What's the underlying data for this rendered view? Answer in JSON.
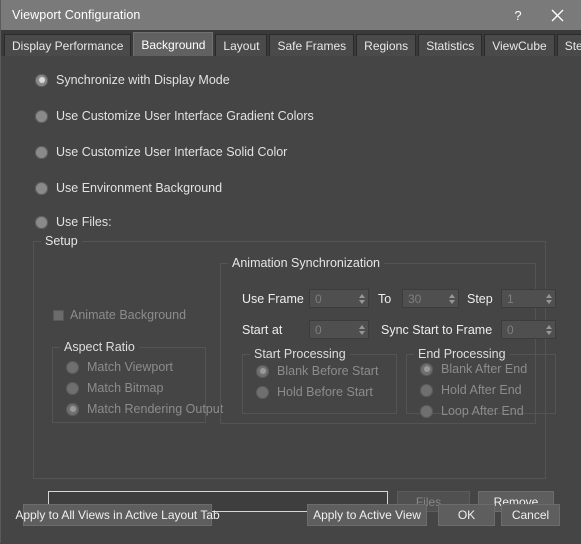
{
  "window": {
    "title": "Viewport Configuration",
    "help_label": "?",
    "close_label": "✕"
  },
  "tabs": [
    {
      "label": "Display Performance",
      "active": false
    },
    {
      "label": "Background",
      "active": true
    },
    {
      "label": "Layout",
      "active": false
    },
    {
      "label": "Safe Frames",
      "active": false
    },
    {
      "label": "Regions",
      "active": false
    },
    {
      "label": "Statistics",
      "active": false
    },
    {
      "label": "ViewCube",
      "active": false
    },
    {
      "label": "SteeringWheels",
      "active": false
    }
  ],
  "background_options": [
    {
      "label": "Synchronize with Display Mode",
      "selected": true
    },
    {
      "label": "Use Customize User Interface Gradient Colors",
      "selected": false
    },
    {
      "label": "Use Customize User Interface Solid Color",
      "selected": false
    },
    {
      "label": "Use Environment Background",
      "selected": false
    },
    {
      "label": "Use Files:",
      "selected": false
    }
  ],
  "setup": {
    "title": "Setup",
    "animate_background": {
      "label": "Animate Background",
      "checked": false,
      "enabled": false
    },
    "aspect_ratio": {
      "title": "Aspect Ratio",
      "options": [
        {
          "label": "Match Viewport",
          "selected": false
        },
        {
          "label": "Match Bitmap",
          "selected": false
        },
        {
          "label": "Match Rendering Output",
          "selected": true
        }
      ]
    },
    "animation_sync": {
      "title": "Animation Synchronization",
      "use_frame_label": "Use Frame",
      "use_frame_value": "0",
      "to_label": "To",
      "to_value": "30",
      "step_label": "Step",
      "step_value": "1",
      "start_at_label": "Start at",
      "start_at_value": "0",
      "sync_start_label": "Sync Start to Frame",
      "sync_start_value": "0"
    },
    "start_processing": {
      "title": "Start Processing",
      "options": [
        {
          "label": "Blank Before Start",
          "selected": true
        },
        {
          "label": "Hold Before Start",
          "selected": false
        }
      ]
    },
    "end_processing": {
      "title": "End Processing",
      "options": [
        {
          "label": "Blank After End",
          "selected": true
        },
        {
          "label": "Hold After End",
          "selected": false
        },
        {
          "label": "Loop After End",
          "selected": false
        }
      ]
    },
    "path_value": "",
    "path_placeholder": "",
    "files_button": "Files...",
    "remove_button": "Remove"
  },
  "footer": {
    "apply_all_views": "Apply to All Views in Active Layout Tab",
    "apply_active_view": "Apply to Active View",
    "ok": "OK",
    "cancel": "Cancel"
  },
  "colors": {
    "window_bg": "#454545",
    "titlebar_bg": "#7a7a7a",
    "tabstrip_bg": "#3a3a3a",
    "tab_active_bg": "#616161",
    "accent_border": "#d6d6d6"
  }
}
